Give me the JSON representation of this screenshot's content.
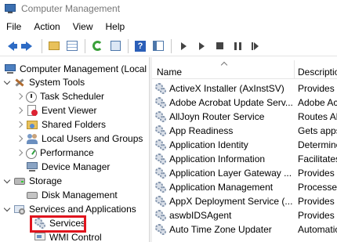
{
  "window": {
    "title": "Computer Management"
  },
  "menu": [
    "File",
    "Action",
    "View",
    "Help"
  ],
  "toolbar": {
    "buttons": [
      "back-icon",
      "forward-icon",
      "up-folder-icon",
      "show-hide-tree-icon",
      "refresh-icon",
      "export-list-icon",
      "help-icon",
      "properties-icon",
      "start-service-icon",
      "start-service-alt-icon",
      "stop-service-icon",
      "pause-service-icon",
      "restart-service-icon"
    ]
  },
  "tree": {
    "root": "Computer Management (Local",
    "system_tools": "System Tools",
    "task_scheduler": "Task Scheduler",
    "event_viewer": "Event Viewer",
    "shared_folders": "Shared Folders",
    "local_users": "Local Users and Groups",
    "performance": "Performance",
    "device_manager": "Device Manager",
    "storage": "Storage",
    "disk_management": "Disk Management",
    "services_apps": "Services and Applications",
    "services": "Services",
    "wmi_control": "WMI Control"
  },
  "highlight_color": "#e0141e",
  "list": {
    "columns": {
      "name": "Name",
      "description": "Description"
    },
    "rows": [
      {
        "name": "ActiveX Installer (AxInstSV)",
        "description": "Provides U"
      },
      {
        "name": "Adobe Acrobat Update Serv...",
        "description": "Adobe Acro"
      },
      {
        "name": "AllJoyn Router Service",
        "description": "Routes AllJ"
      },
      {
        "name": "App Readiness",
        "description": "Gets apps r"
      },
      {
        "name": "Application Identity",
        "description": "Determine"
      },
      {
        "name": "Application Information",
        "description": "Facilitates"
      },
      {
        "name": "Application Layer Gateway ...",
        "description": "Provides s"
      },
      {
        "name": "Application Management",
        "description": "Processes i"
      },
      {
        "name": "AppX Deployment Service (...",
        "description": "Provides in"
      },
      {
        "name": "aswbIDSAgent",
        "description": "Provides s"
      },
      {
        "name": "Auto Time Zone Updater",
        "description": "Automatic"
      }
    ]
  }
}
